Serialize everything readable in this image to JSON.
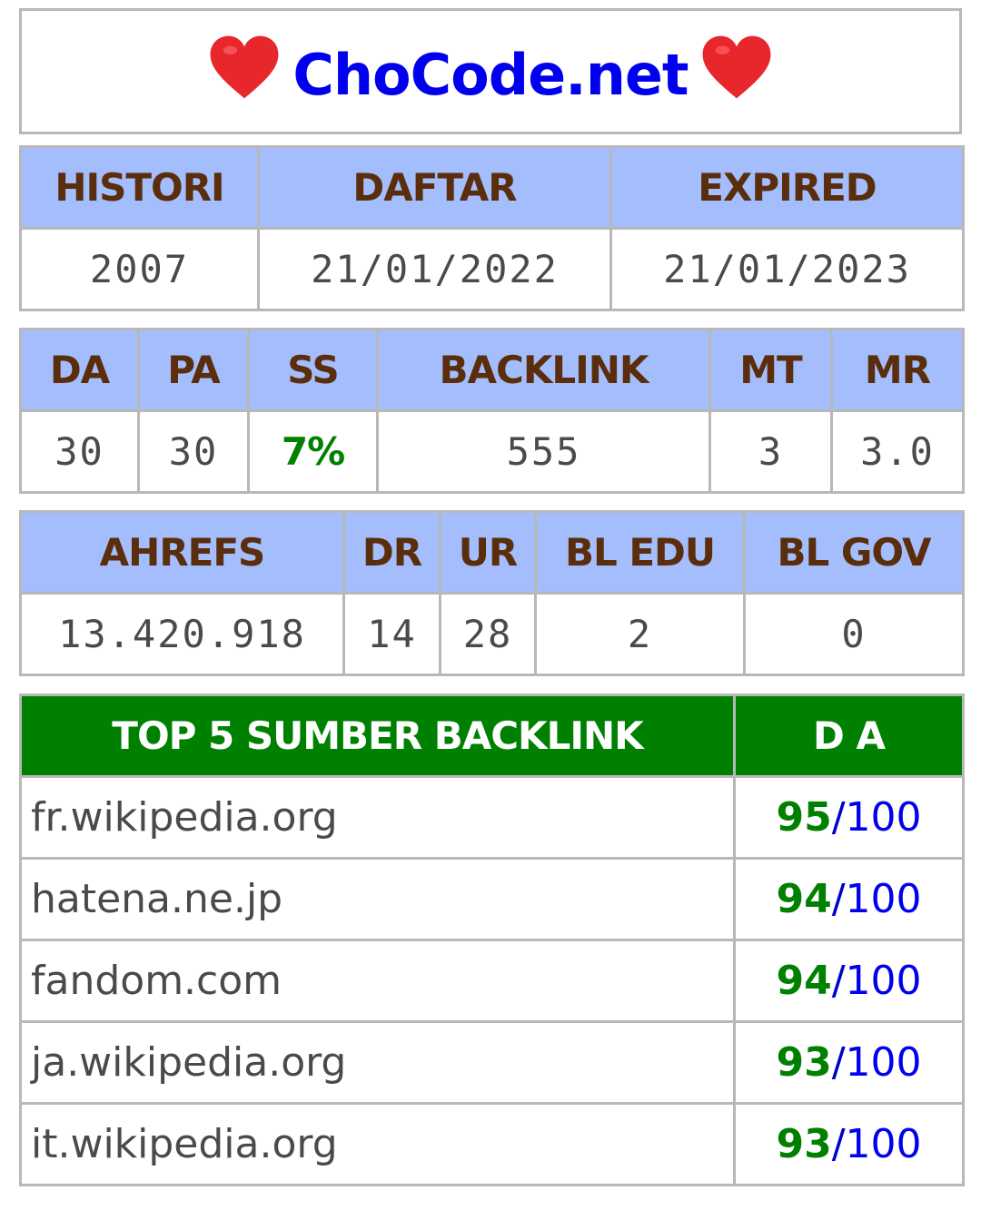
{
  "site": {
    "title": "ChoCode.net",
    "left_icon": "heart-icon",
    "right_icon": "heart-icon",
    "title_color": "#0000ee",
    "heart_color": "#e8272d"
  },
  "dates": {
    "headers": [
      "HISTORI",
      "DAFTAR",
      "EXPIRED"
    ],
    "values": [
      "2007",
      "21/01/2022",
      "21/01/2023"
    ]
  },
  "moz": {
    "headers": [
      "DA",
      "PA",
      "SS",
      "BACKLINK",
      "MT",
      "MR"
    ],
    "values": [
      "30",
      "30",
      "7%",
      "555",
      "3",
      "3.0"
    ]
  },
  "ahrefs": {
    "headers": [
      "AHREFS",
      "DR",
      "UR",
      "BL EDU",
      "BL GOV"
    ],
    "values": [
      "13.420.918",
      "14",
      "28",
      "2",
      "0"
    ]
  },
  "backlinks": {
    "headers": [
      "TOP 5 SUMBER BACKLINK",
      "D A"
    ],
    "rows": [
      {
        "domain": "fr.wikipedia.org",
        "da": "95",
        "sep": "/",
        "max": "100"
      },
      {
        "domain": "hatena.ne.jp",
        "da": "94",
        "sep": "/",
        "max": "100"
      },
      {
        "domain": "fandom.com",
        "da": "94",
        "sep": "/",
        "max": "100"
      },
      {
        "domain": "ja.wikipedia.org",
        "da": "93",
        "sep": "/",
        "max": "100"
      },
      {
        "domain": "it.wikipedia.org",
        "da": "93",
        "sep": "/",
        "max": "100"
      }
    ]
  },
  "colors": {
    "header_bg": "#a4bdfc",
    "header_text": "#5a2d0c",
    "green_header_bg": "#008000",
    "green_text": "#008000",
    "border": "#b8b8b8"
  }
}
